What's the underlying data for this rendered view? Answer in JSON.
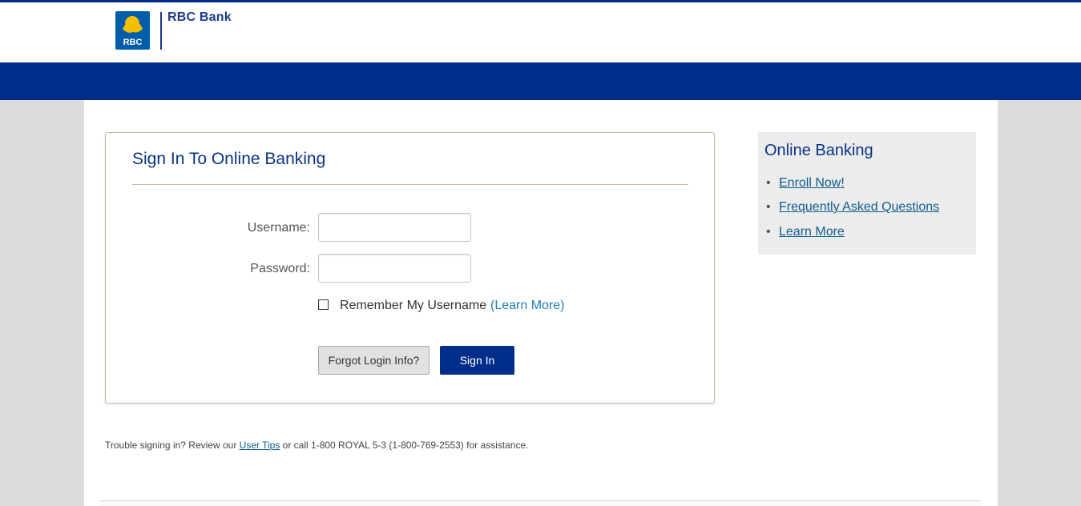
{
  "brand": {
    "logo_text": "RBC Bank",
    "shield_text": "RBC",
    "icon": "rbc-lion-shield-icon",
    "primary_color": "#002d8a",
    "shield_yellow": "#f2c000"
  },
  "login": {
    "title": "Sign In To Online Banking",
    "username_label": "Username:",
    "password_label": "Password:",
    "username_value": "",
    "password_value": "",
    "remember_label": "Remember My Username",
    "remember_checked": false,
    "learn_more_link": "(Learn More)",
    "forgot_button": "Forgot Login Info?",
    "signin_button": "Sign In"
  },
  "sidebar": {
    "title": "Online Banking",
    "items": [
      {
        "label": "Enroll Now!"
      },
      {
        "label": "Frequently Asked Questions"
      },
      {
        "label": "Learn More"
      }
    ]
  },
  "footer": {
    "trouble_prefix": "Trouble signing in? Review our ",
    "user_tips_link": "User Tips",
    "trouble_suffix": " or call 1-800 ROYAL 5-3 (1-800-769-2553) for assistance."
  }
}
